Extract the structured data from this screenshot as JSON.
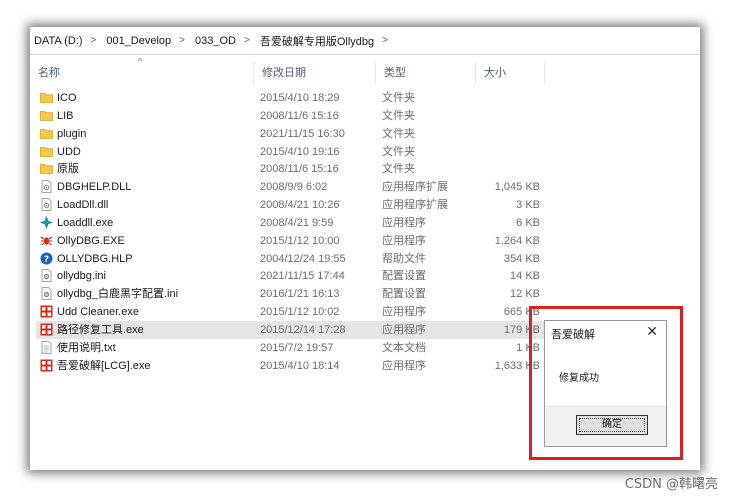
{
  "breadcrumb": [
    "DATA (D:)",
    "001_Develop",
    "033_OD",
    "吾爱破解专用版Ollydbg"
  ],
  "columns": {
    "name": "名称",
    "date": "修改日期",
    "type": "类型",
    "size": "大小"
  },
  "files": [
    {
      "name": "ICO",
      "date": "2015/4/10 18:29",
      "type": "文件夹",
      "size": "",
      "icon": "folder-icon"
    },
    {
      "name": "LIB",
      "date": "2008/11/6 15:16",
      "type": "文件夹",
      "size": "",
      "icon": "folder-icon"
    },
    {
      "name": "plugin",
      "date": "2021/11/15 16:30",
      "type": "文件夹",
      "size": "",
      "icon": "folder-icon"
    },
    {
      "name": "UDD",
      "date": "2015/4/10 19:16",
      "type": "文件夹",
      "size": "",
      "icon": "folder-icon"
    },
    {
      "name": "原版",
      "date": "2008/11/6 15:16",
      "type": "文件夹",
      "size": "",
      "icon": "folder-icon"
    },
    {
      "name": "DBGHELP.DLL",
      "date": "2008/9/9 6:02",
      "type": "应用程序扩展",
      "size": "1,045 KB",
      "icon": "dll-icon"
    },
    {
      "name": "LoadDll.dll",
      "date": "2008/4/21 10:26",
      "type": "应用程序扩展",
      "size": "3 KB",
      "icon": "dll-icon"
    },
    {
      "name": "Loaddll.exe",
      "date": "2008/4/21 9:59",
      "type": "应用程序",
      "size": "6 KB",
      "icon": "loaddll-exe-icon"
    },
    {
      "name": "OllyDBG.EXE",
      "date": "2015/1/12 10:00",
      "type": "应用程序",
      "size": "1,264 KB",
      "icon": "ollydbg-bug-icon"
    },
    {
      "name": "OLLYDBG.HLP",
      "date": "2004/12/24 19:55",
      "type": "帮助文件",
      "size": "354 KB",
      "icon": "help-file-icon"
    },
    {
      "name": "ollydbg.ini",
      "date": "2021/11/15 17:44",
      "type": "配置设置",
      "size": "14 KB",
      "icon": "config-file-icon"
    },
    {
      "name": "ollydbg_白鹿黑字配置.ini",
      "date": "2016/1/21 16:13",
      "type": "配置设置",
      "size": "12 KB",
      "icon": "config-file-icon"
    },
    {
      "name": "Udd Cleaner.exe",
      "date": "2015/1/12 10:02",
      "type": "应用程序",
      "size": "665 KB",
      "icon": "red-app-icon"
    },
    {
      "name": "路径修复工具.exe",
      "date": "2015/12/14 17:28",
      "type": "应用程序",
      "size": "179 KB",
      "icon": "red-app-icon",
      "selected": true
    },
    {
      "name": "使用说明.txt",
      "date": "2015/7/2 19:57",
      "type": "文本文档",
      "size": "1 KB",
      "icon": "text-file-icon"
    },
    {
      "name": "吾爱破解[LCG].exe",
      "date": "2015/4/10 18:14",
      "type": "应用程序",
      "size": "1,633 KB",
      "icon": "red-app-icon"
    }
  ],
  "dialog": {
    "title": "吾爱破解",
    "close": "✕",
    "message": "修复成功",
    "ok_label": "确定"
  },
  "watermark": "CSDN @韩曙亮",
  "colors": {
    "highlight_border": "#e01e1e",
    "selected_row": "#e5e5e5",
    "folder": "#f6c94a"
  }
}
